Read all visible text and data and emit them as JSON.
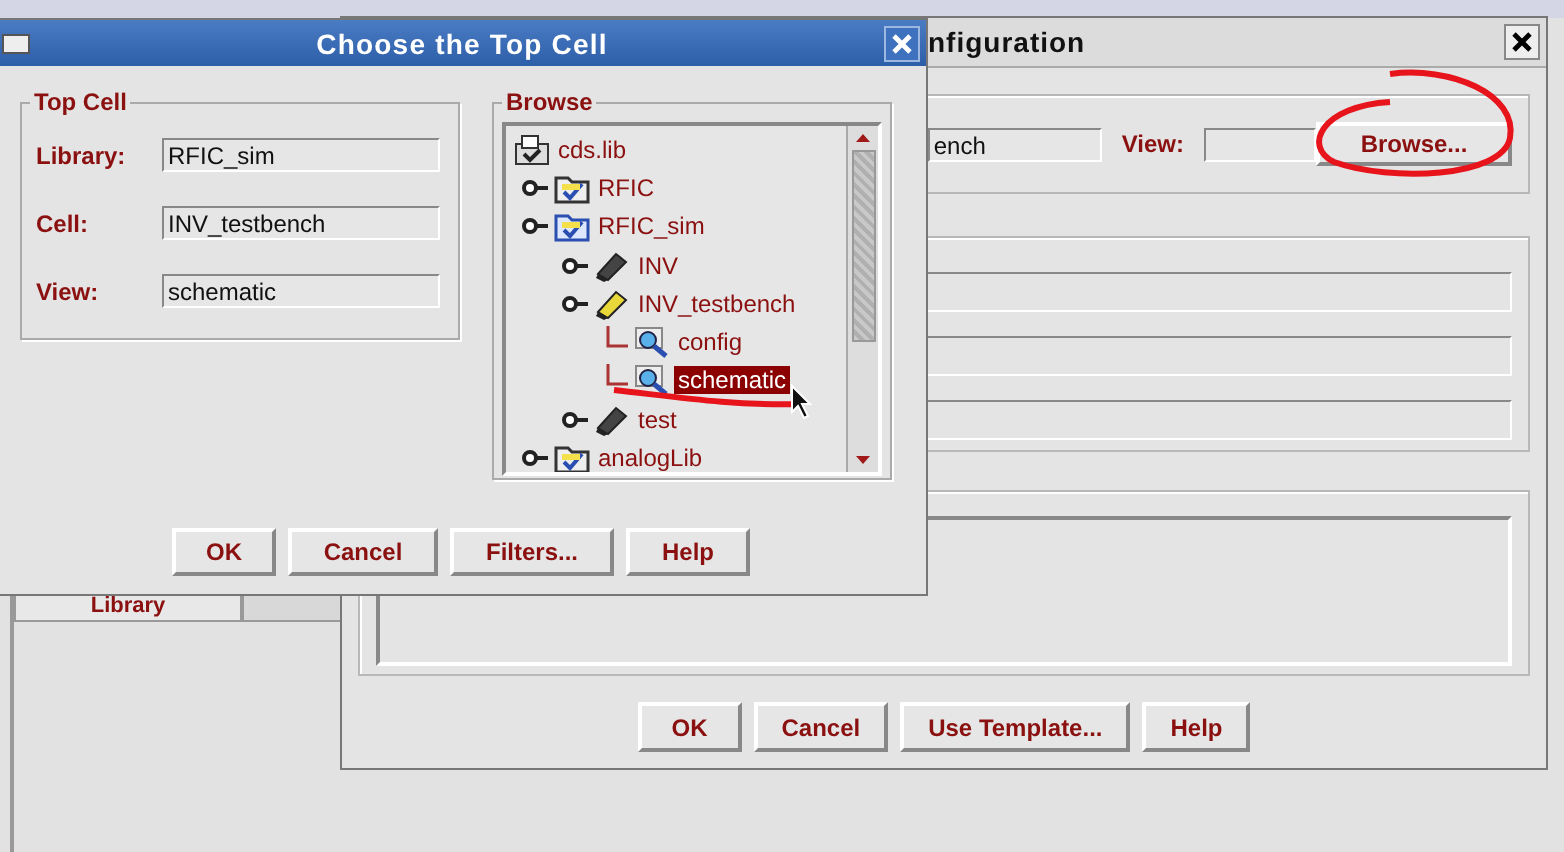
{
  "library_panel": {
    "tabs": [
      {
        "label": "Library",
        "selected": true
      }
    ]
  },
  "config_window": {
    "title": "nfiguration",
    "cell_value": "ench",
    "view_label": "View:",
    "browse_button": "Browse...",
    "buttons": [
      "OK",
      "Cancel",
      "Use Template...",
      "Help"
    ]
  },
  "top_cell_dialog": {
    "title": "Choose the Top Cell",
    "top_cell_group": {
      "title": "Top Cell",
      "fields": [
        {
          "label": "Library:",
          "value": "RFIC_sim"
        },
        {
          "label": "Cell:",
          "value": "INV_testbench"
        },
        {
          "label": "View:",
          "value": "schematic"
        }
      ]
    },
    "browse_group": {
      "title": "Browse",
      "tree": [
        {
          "label": "cds.lib",
          "kind": "root",
          "selected": false,
          "children": [
            {
              "label": "RFIC",
              "kind": "library",
              "selected": false
            },
            {
              "label": "RFIC_sim",
              "kind": "library",
              "selected": false,
              "children": [
                {
                  "label": "INV",
                  "kind": "cell",
                  "selected": false
                },
                {
                  "label": "INV_testbench",
                  "kind": "cell",
                  "selected": false,
                  "children": [
                    {
                      "label": "config",
                      "kind": "view",
                      "selected": false
                    },
                    {
                      "label": "schematic",
                      "kind": "view",
                      "selected": true
                    }
                  ]
                },
                {
                  "label": "test",
                  "kind": "cell",
                  "selected": false
                }
              ]
            },
            {
              "label": "analogLib",
              "kind": "library",
              "selected": false
            }
          ]
        }
      ]
    },
    "buttons": [
      "OK",
      "Cancel",
      "Filters...",
      "Help"
    ]
  }
}
